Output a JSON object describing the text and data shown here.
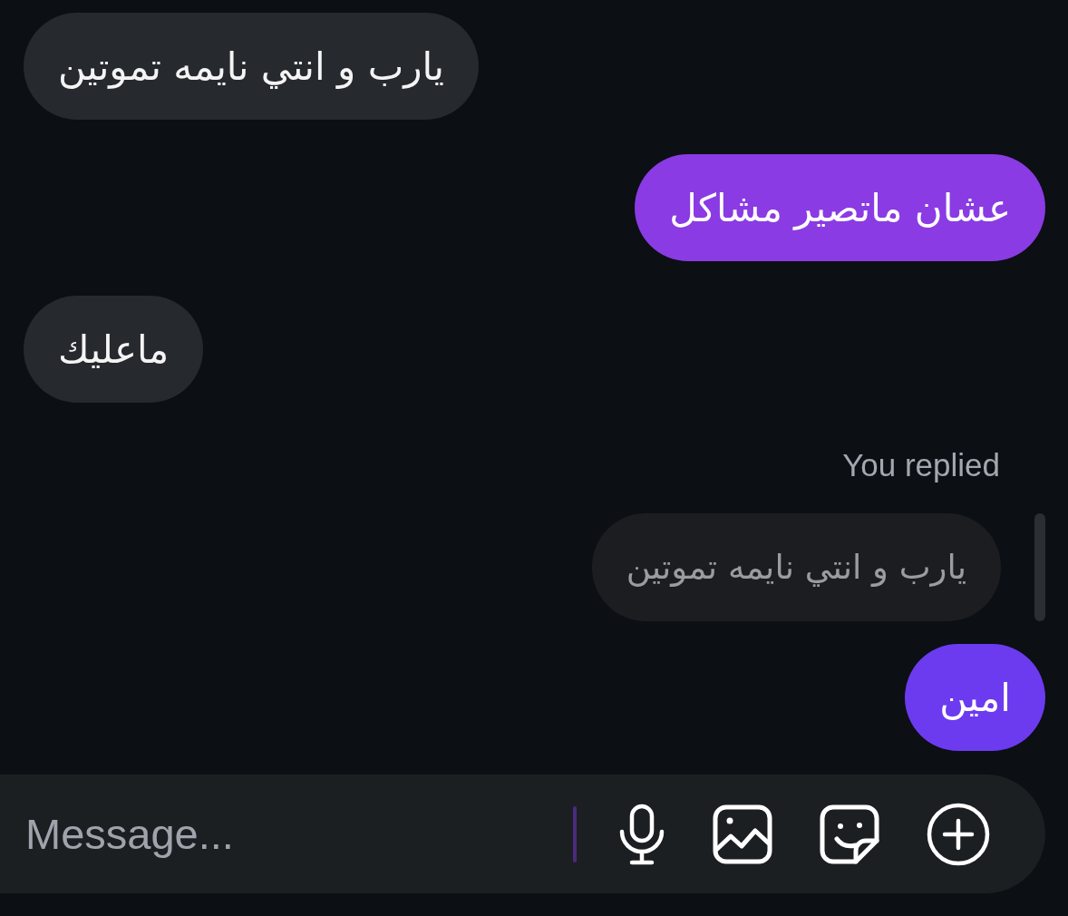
{
  "messages": [
    {
      "kind": "received",
      "text": "يارب و انتي نايمه تموتين"
    },
    {
      "kind": "sent",
      "text": "عشان ماتصير مشاكل",
      "color": "#8a3be3"
    },
    {
      "kind": "received",
      "text": "ماعليك"
    },
    {
      "kind": "sent",
      "text": "امين",
      "color": "#6c3bef",
      "reply": {
        "label": "You replied",
        "quote": "يارب و انتي نايمه تموتين"
      }
    }
  ],
  "composer": {
    "placeholder": "Message..."
  }
}
